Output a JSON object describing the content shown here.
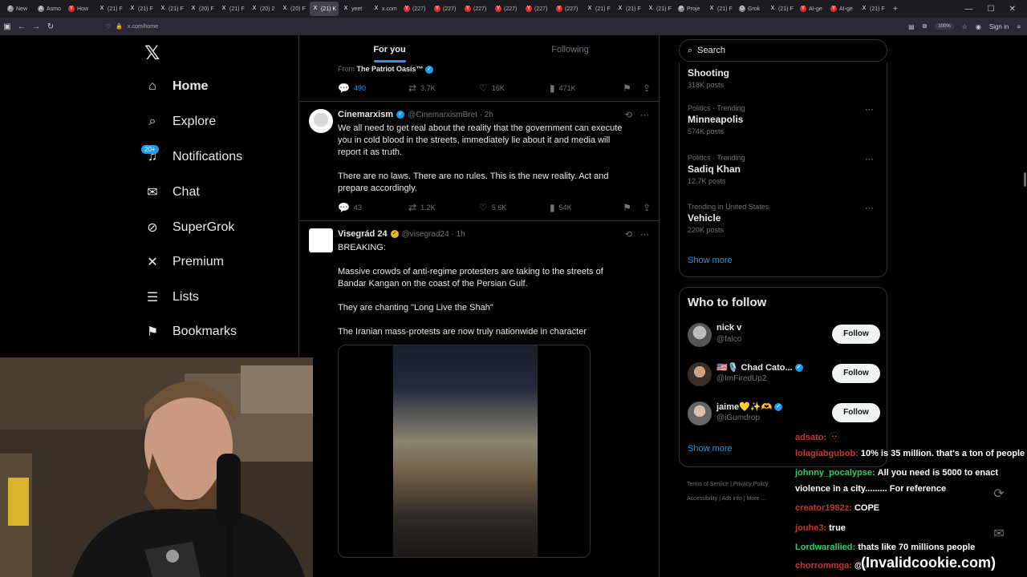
{
  "browser": {
    "tabs": [
      {
        "label": "New",
        "fav": "F"
      },
      {
        "label": "Asmo",
        "fav": "A"
      },
      {
        "label": "How",
        "fav": "Y"
      },
      {
        "label": "(21) F",
        "fav": "X"
      },
      {
        "label": "(21) F",
        "fav": "X"
      },
      {
        "label": "(21) F",
        "fav": "X"
      },
      {
        "label": "(20) F",
        "fav": "X"
      },
      {
        "label": "(21) F",
        "fav": "X"
      },
      {
        "label": "(20) 2",
        "fav": "X"
      },
      {
        "label": "(20) F",
        "fav": "X"
      },
      {
        "label": "(21) K",
        "fav": "X",
        "active": true
      },
      {
        "label": "yeet",
        "fav": "X"
      },
      {
        "label": "x.com",
        "fav": "X"
      },
      {
        "label": "(227)",
        "fav": "Y"
      },
      {
        "label": "(227)",
        "fav": "Y"
      },
      {
        "label": "(227)",
        "fav": "Y"
      },
      {
        "label": "(227)",
        "fav": "Y"
      },
      {
        "label": "(227)",
        "fav": "Y"
      },
      {
        "label": "(227)",
        "fav": "Y"
      },
      {
        "label": "(21) F",
        "fav": "X"
      },
      {
        "label": "(21) F",
        "fav": "X"
      },
      {
        "label": "(21) F",
        "fav": "X"
      },
      {
        "label": "Proje",
        "fav": "P"
      },
      {
        "label": "(21) F",
        "fav": "X"
      },
      {
        "label": "Grok",
        "fav": "G"
      },
      {
        "label": "(21) F",
        "fav": "X"
      },
      {
        "label": "AI-ge",
        "fav": "Y"
      },
      {
        "label": "AI-ge",
        "fav": "Y"
      },
      {
        "label": "(21) F",
        "fav": "X"
      }
    ],
    "url": "x.com/home",
    "zoom": "100%",
    "signin": "Sign in"
  },
  "nav": {
    "items": [
      {
        "label": "Home",
        "icon": "home-icon",
        "glyph": "⌂"
      },
      {
        "label": "Explore",
        "icon": "search-icon",
        "glyph": "⌕"
      },
      {
        "label": "Notifications",
        "icon": "bell-icon",
        "glyph": "♫"
      },
      {
        "label": "Chat",
        "icon": "mail-icon",
        "glyph": "✉"
      },
      {
        "label": "SuperGrok",
        "icon": "grok-icon",
        "glyph": "⊘"
      },
      {
        "label": "Premium",
        "icon": "x-premium-icon",
        "glyph": "✕"
      },
      {
        "label": "Lists",
        "icon": "list-icon",
        "glyph": "☰"
      },
      {
        "label": "Bookmarks",
        "icon": "bookmark-icon",
        "glyph": "⚑"
      }
    ],
    "notif_count": "20+"
  },
  "feed": {
    "tabs": [
      "For you",
      "Following"
    ],
    "top_post": {
      "from_prefix": "From",
      "from_name": "The Patriot Oasis™",
      "replies": "490",
      "reposts": "3.7K",
      "likes": "16K",
      "views": "471K"
    },
    "post1": {
      "name": "Cinemarxism",
      "handle": "@CinemarxismBret · 2h",
      "paragraphs": [
        "We all need to get real about the reality that the government can execute you in cold blood in the streets, immediately lie about it and media will report it as truth.",
        "There are no laws. There are no rules. This is the new reality. Act and prepare accordingly."
      ],
      "replies": "43",
      "reposts": "1.2K",
      "likes": "5.6K",
      "views": "54K"
    },
    "post2": {
      "name": "Visegrád 24",
      "handle": "@visegrad24 · 1h",
      "paragraphs": [
        "BREAKING:",
        "Massive crowds of anti-regime protesters are taking to the streets of Bandar Kangan on the coast of the Persian Gulf.",
        "They are chanting \"Long Live the Shah\"",
        "The Iranian mass-protests are now truly nationwide in character"
      ]
    }
  },
  "right": {
    "search_placeholder": "Search",
    "trends": [
      {
        "category": "",
        "title": "Shooting",
        "posts": "318K posts"
      },
      {
        "category": "Politics · Trending",
        "title": "Minneapolis",
        "posts": "574K posts"
      },
      {
        "category": "Politics · Trending",
        "title": "Sadiq Khan",
        "posts": "12.7K posts"
      },
      {
        "category": "Trending in United States",
        "title": "Vehicle",
        "posts": "220K posts"
      }
    ],
    "show_more": "Show more",
    "who_to_follow": {
      "title": "Who to follow",
      "accounts": [
        {
          "name": "nick v",
          "handle": "@falco",
          "avatar_color": "#8a8a8a"
        },
        {
          "name": "🇺🇸🎙️ Chad Cato...",
          "handle": "@ImFiredUp2",
          "avatar_color": "#4a3a30"
        },
        {
          "name": "jaime💛✨🫶",
          "handle": "@iGumdrop",
          "avatar_color": "#777777"
        }
      ],
      "follow_label": "Follow",
      "show_more": "Show more"
    },
    "footer": [
      "Terms of Service",
      "|",
      "Privacy Policy",
      "Accessibility",
      "|",
      "Ads info",
      "|",
      "More ..."
    ]
  },
  "chat": {
    "lines": [
      {
        "user": "adsato:",
        "text": "🫥",
        "color": "#c0392b"
      },
      {
        "user": "lolagiabgubob:",
        "text": "10% is 35 million. that's a ton of people",
        "color": "#c0392b"
      },
      {
        "user": "johnny_pocalypse:",
        "text": "All you need is 5000 to enact",
        "color": "#2ecc71"
      },
      {
        "user": "",
        "text": "violence in a city......... For reference",
        "color": "#ffffff"
      },
      {
        "user": "creator1982z:",
        "text": "COPE",
        "color": "#c0392b"
      },
      {
        "user": "jouhe3:",
        "text": "true",
        "color": "#c0392b"
      },
      {
        "user": "Lordwarallied:",
        "text": "thats like 70 millions people",
        "color": "#2ecc71"
      },
      {
        "user": "chorrommga:",
        "text": "@y",
        "color": "#c0392b"
      }
    ]
  },
  "watermark": "(Invalidcookie.com)"
}
